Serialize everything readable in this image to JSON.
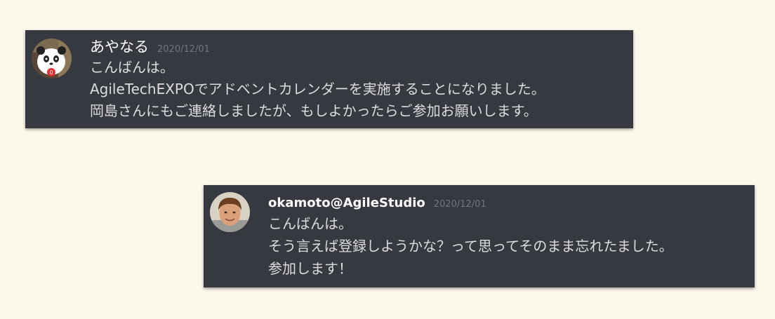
{
  "messages": [
    {
      "username": "あやなる",
      "timestamp": "2020/12/01",
      "avatar_icon": "panda-avatar-icon",
      "lines": [
        "こんばんは。",
        "AgileTechEXPOでアドベントカレンダーを実施することになりました。",
        "岡島さんにもご連絡しましたが、もしよかったらご参加お願いします。"
      ]
    },
    {
      "username": "okamoto@AgileStudio",
      "timestamp": "2020/12/01",
      "avatar_icon": "user-photo-avatar-icon",
      "lines": [
        "こんばんは。",
        "そう言えば登録しようかな？って思ってそのまま忘れたました。",
        "参加します！"
      ]
    }
  ],
  "colors": {
    "page_background": "#fdf8ec",
    "message_background": "#36393f",
    "username": "#ffffff",
    "timestamp": "#72767d",
    "text": "#dcddde"
  }
}
